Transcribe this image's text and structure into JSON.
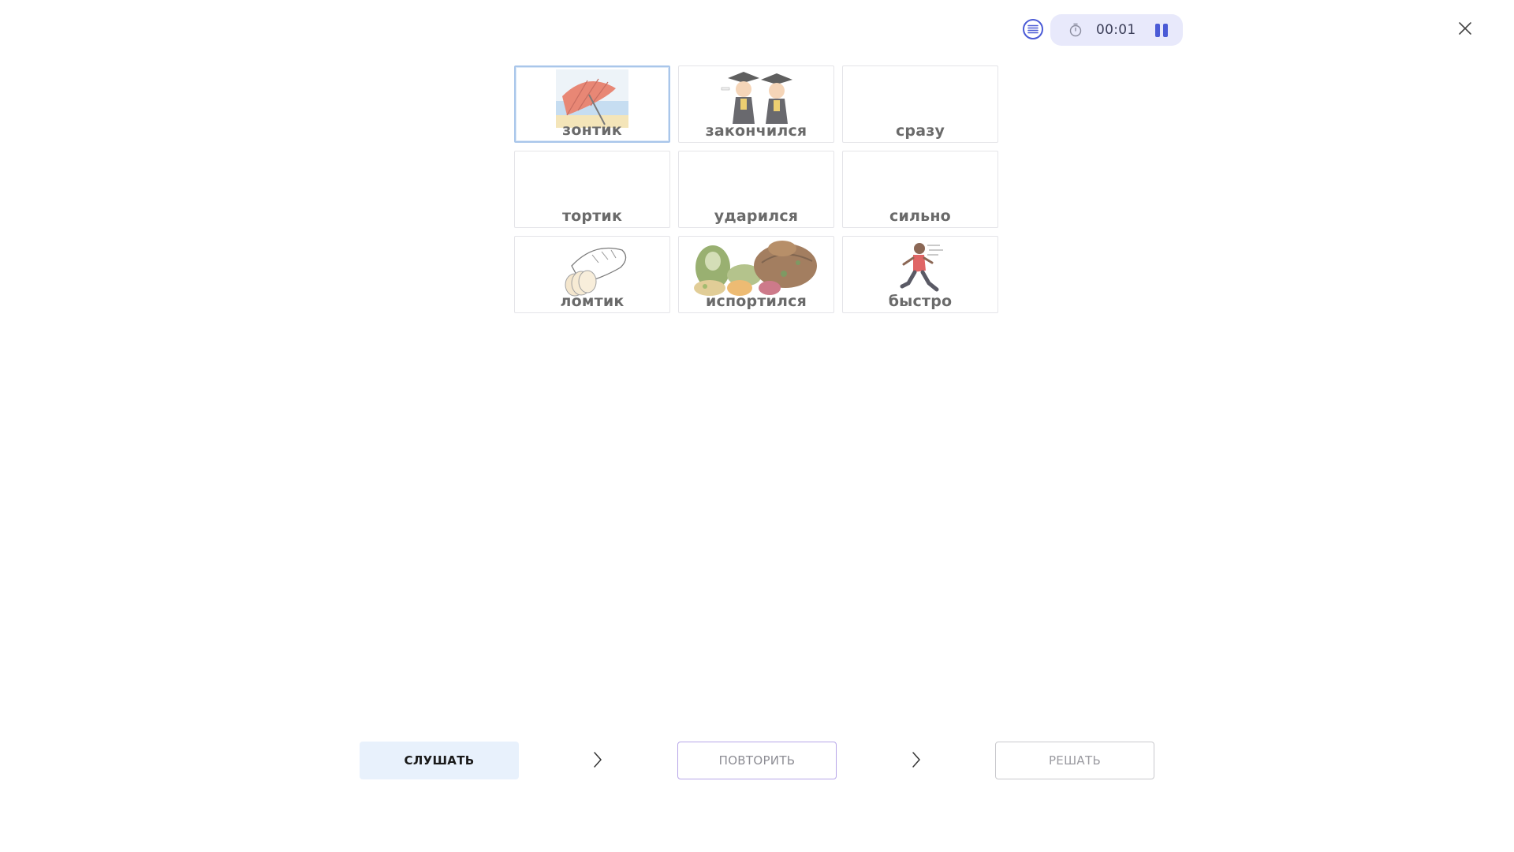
{
  "header": {
    "menu_icon": "list-icon",
    "timer_icon": "stopwatch-icon",
    "timer": "00:01",
    "pause_icon": "pause-icon",
    "close_icon": "close-icon",
    "accent_color": "#4b5bd6"
  },
  "cards": [
    {
      "word": "зонтик",
      "picture": "umbrella-image",
      "selected": true
    },
    {
      "word": "закончился",
      "picture": "graduates-image",
      "selected": false
    },
    {
      "word": "сразу",
      "picture": "",
      "selected": false
    },
    {
      "word": "тортик",
      "picture": "",
      "selected": false
    },
    {
      "word": "ударился",
      "picture": "",
      "selected": false
    },
    {
      "word": "сильно",
      "picture": "",
      "selected": false
    },
    {
      "word": "ломтик",
      "picture": "bread-slice-image",
      "selected": false
    },
    {
      "word": "испортился",
      "picture": "spoiled-food-image",
      "selected": false
    },
    {
      "word": "быстро",
      "picture": "running-boy-image",
      "selected": false
    }
  ],
  "controls": {
    "listen_label": "СЛУШАТЬ",
    "repeat_label": "ПОВТОРИТЬ",
    "solve_label": "РЕШАТЬ",
    "step_icon": "chevron-right-icon"
  }
}
